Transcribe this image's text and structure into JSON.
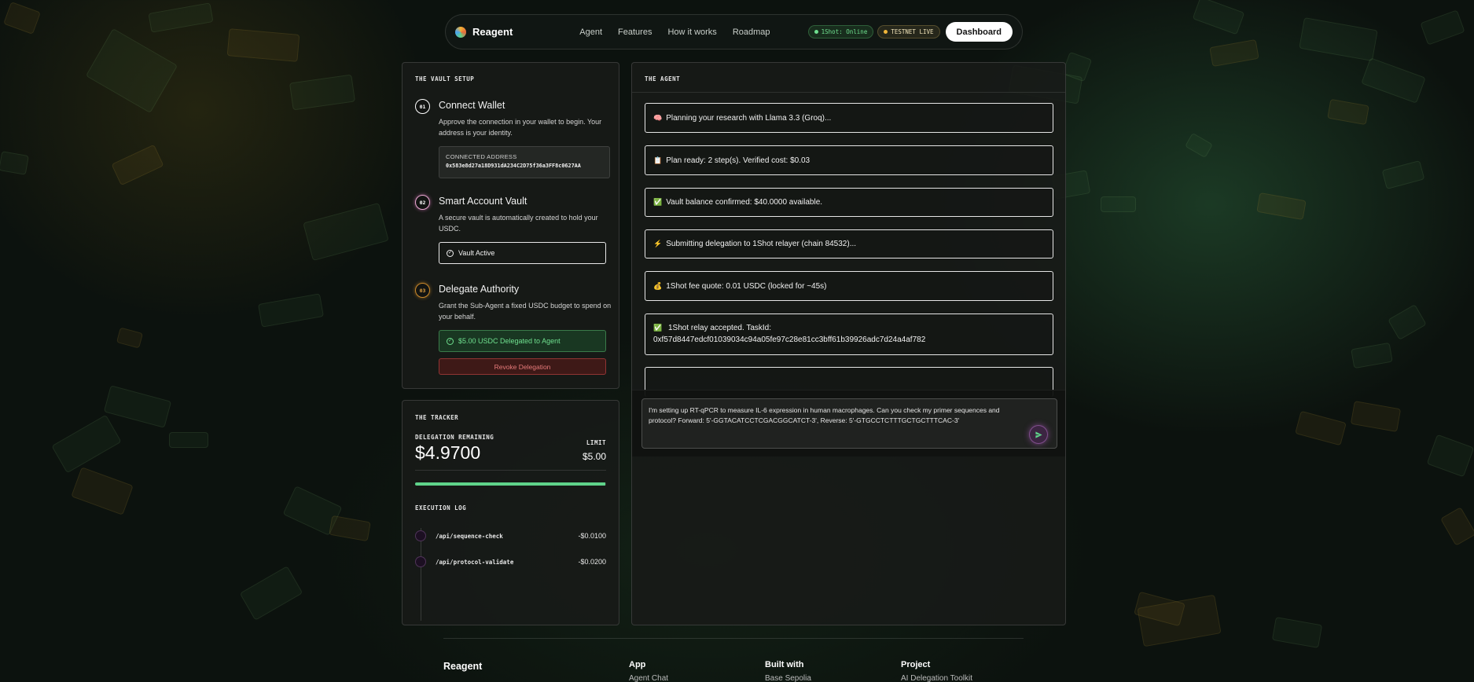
{
  "nav": {
    "brand": "Reagent",
    "links": [
      "Agent",
      "Features",
      "How it works",
      "Roadmap"
    ],
    "status_pill": "1Shot: Online",
    "testnet_pill": "TESTNET LIVE",
    "dashboard_button": "Dashboard",
    "colors": {
      "online": "#6fe08f",
      "testnet": "#f0b53a"
    }
  },
  "vault": {
    "title": "THE VAULT SETUP",
    "steps": [
      {
        "num": "01",
        "title": "Connect Wallet",
        "desc": "Approve the connection in your wallet to begin. Your address is your identity.",
        "address_label": "CONNECTED ADDRESS",
        "address": "0x583e8d27a18D931dA234C2D75f36a3FF8c0627AA"
      },
      {
        "num": "02",
        "title": "Smart Account Vault",
        "desc": "A secure vault is automatically created to hold your USDC.",
        "status": "Vault Active"
      },
      {
        "num": "03",
        "title": "Delegate Authority",
        "desc": "Grant the Sub-Agent a fixed USDC budget to spend on your behalf.",
        "status": "$5.00 USDC Delegated to Agent",
        "revoke": "Revoke Delegation"
      }
    ]
  },
  "tracker": {
    "title": "THE TRACKER",
    "remaining_label": "DELEGATION REMAINING",
    "remaining": "$4.9700",
    "limit_label": "LIMIT",
    "limit": "$5.00",
    "remaining_fraction": 0.994,
    "log_title": "EXECUTION LOG",
    "log": [
      {
        "endpoint": "/api/sequence-check",
        "cost": "-$0.0100"
      },
      {
        "endpoint": "/api/protocol-validate",
        "cost": "-$0.0200"
      }
    ]
  },
  "agent": {
    "title": "THE AGENT",
    "messages": [
      {
        "icon": "🧠",
        "text": "Planning your research with Llama 3.3 (Groq)..."
      },
      {
        "icon": "📋",
        "text": "Plan ready: 2 step(s). Verified cost: $0.03"
      },
      {
        "icon": "✅",
        "text": "Vault balance confirmed: $40.0000 available."
      },
      {
        "icon": "⚡",
        "text": "Submitting delegation to 1Shot relayer (chain 84532)..."
      },
      {
        "icon": "💰",
        "text": "1Shot fee quote: 0.01 USDC (locked for ~45s)"
      },
      {
        "icon": "✅",
        "text": "1Shot relay accepted. TaskId:",
        "text2": "0xf57d8447edcf01039034c94a05fe97c28e81cc3bff61b39926adc7d24a4af782"
      }
    ],
    "input_value": "I'm setting up RT-qPCR to measure IL-6 expression in human macrophages. Can you check my primer sequences and protocol? Forward: 5'-GGTACATCCTCGACGGCATCT-3', Reverse: 5'-GTGCCTCTTTGCTGCTTTCAC-3'"
  },
  "footer": {
    "brand": "Reagent",
    "columns": [
      {
        "heading": "App",
        "first": "Agent Chat"
      },
      {
        "heading": "Built with",
        "first": "Base Sepolia"
      },
      {
        "heading": "Project",
        "first": "AI Delegation Toolkit"
      }
    ]
  }
}
